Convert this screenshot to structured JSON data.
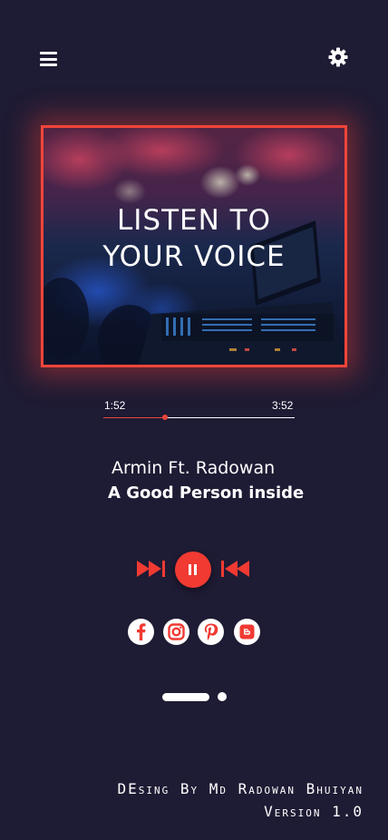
{
  "header": {
    "menu_icon": "hamburger-menu-icon",
    "settings_icon": "gear-icon"
  },
  "cover": {
    "title_line1": "LISTEN TO",
    "title_line2": "YOUR VOICE",
    "border_color": "#f0453a"
  },
  "player": {
    "elapsed": "1:52",
    "duration": "3:52",
    "progress_fraction": 0.32,
    "accent_color": "#f03a32"
  },
  "track": {
    "artist": "Armin Ft. Radowan",
    "title": "A Good Person inside"
  },
  "controls": {
    "previous_icon": "fast-forward-double-arrow-icon",
    "play_pause_icon": "pause-icon",
    "next_icon": "rewind-double-arrow-icon"
  },
  "social": [
    {
      "icon": "facebook-icon",
      "color": "#f03a32"
    },
    {
      "icon": "instagram-icon",
      "color": "#f03a32"
    },
    {
      "icon": "pinterest-icon",
      "color": "#f03a32"
    },
    {
      "icon": "blogger-icon",
      "color": "#f03a32"
    }
  ],
  "pager": {
    "pages": 2,
    "active_page": 1
  },
  "footer": {
    "credit": "DEsing By Md Radowan Bhuiyan",
    "version": "Version 1.0"
  },
  "colors": {
    "background": "#1e1b34",
    "text": "#ffffff"
  }
}
